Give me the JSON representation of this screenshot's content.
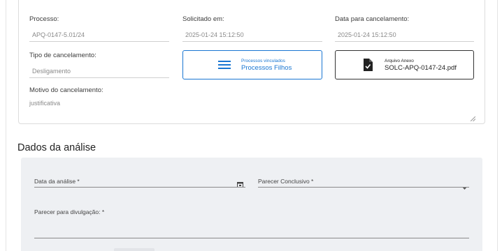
{
  "form": {
    "processo": {
      "label": "Processo:",
      "value": "APQ-0147-5.01/24"
    },
    "solicitado_em": {
      "label": "Solicitado em:",
      "value": "2025-01-24 15:12:50"
    },
    "data_cancelamento": {
      "label": "Data para cancelamento:",
      "value": "2025-01-24 15:12:50"
    },
    "tipo_cancelamento": {
      "label": "Tipo de cancelamento:",
      "value": "Desligamento"
    },
    "processos_vinculados": {
      "caption": "Processos vinculados",
      "title": "Processos Filhos"
    },
    "arquivo_anexo": {
      "caption": "Arquivo Anexo",
      "filename": "SOLC-APQ-0147-24.pdf"
    },
    "motivo": {
      "label": "Motivo do cancelamento:",
      "value": "justificativa"
    }
  },
  "analysis": {
    "title": "Dados da análise",
    "data_analise_label": "Data da análise *",
    "parecer_conclusivo_label": "Parecer Conclusivo *",
    "parecer_divulgacao_label": "Parecer para divulgação: *"
  },
  "colors": {
    "accent": "#1976d2",
    "panel_bg": "#eef0f3"
  }
}
